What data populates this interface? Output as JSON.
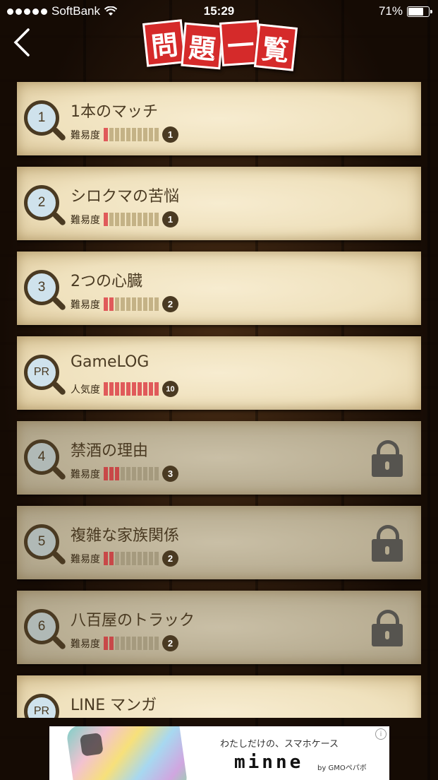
{
  "status": {
    "carrier": "SoftBank",
    "time": "15:29",
    "battery": "71%"
  },
  "header": {
    "title_chars": [
      "問",
      "題",
      "一",
      "覧"
    ]
  },
  "list": [
    {
      "num": "1",
      "title": "1本のマッチ",
      "metric": "難易度",
      "level": 1,
      "value": "1",
      "locked": false
    },
    {
      "num": "2",
      "title": "シロクマの苦悩",
      "metric": "難易度",
      "level": 1,
      "value": "1",
      "locked": false
    },
    {
      "num": "3",
      "title": "2つの心臓",
      "metric": "難易度",
      "level": 2,
      "value": "2",
      "locked": false
    },
    {
      "num": "PR",
      "title": "GameLOG",
      "metric": "人気度",
      "level": 10,
      "value": "10",
      "locked": false
    },
    {
      "num": "4",
      "title": "禁酒の理由",
      "metric": "難易度",
      "level": 3,
      "value": "3",
      "locked": true
    },
    {
      "num": "5",
      "title": "複雑な家族関係",
      "metric": "難易度",
      "level": 2,
      "value": "2",
      "locked": true
    },
    {
      "num": "6",
      "title": "八百屋のトラック",
      "metric": "難易度",
      "level": 2,
      "value": "2",
      "locked": true
    },
    {
      "num": "PR",
      "title": "LINE マンガ",
      "metric": "",
      "level": 0,
      "value": "",
      "locked": false
    }
  ],
  "ad": {
    "tagline": "わたしだけの、スマホケース",
    "brand": "minne",
    "by": "by GMOペパボ",
    "info": "i"
  }
}
